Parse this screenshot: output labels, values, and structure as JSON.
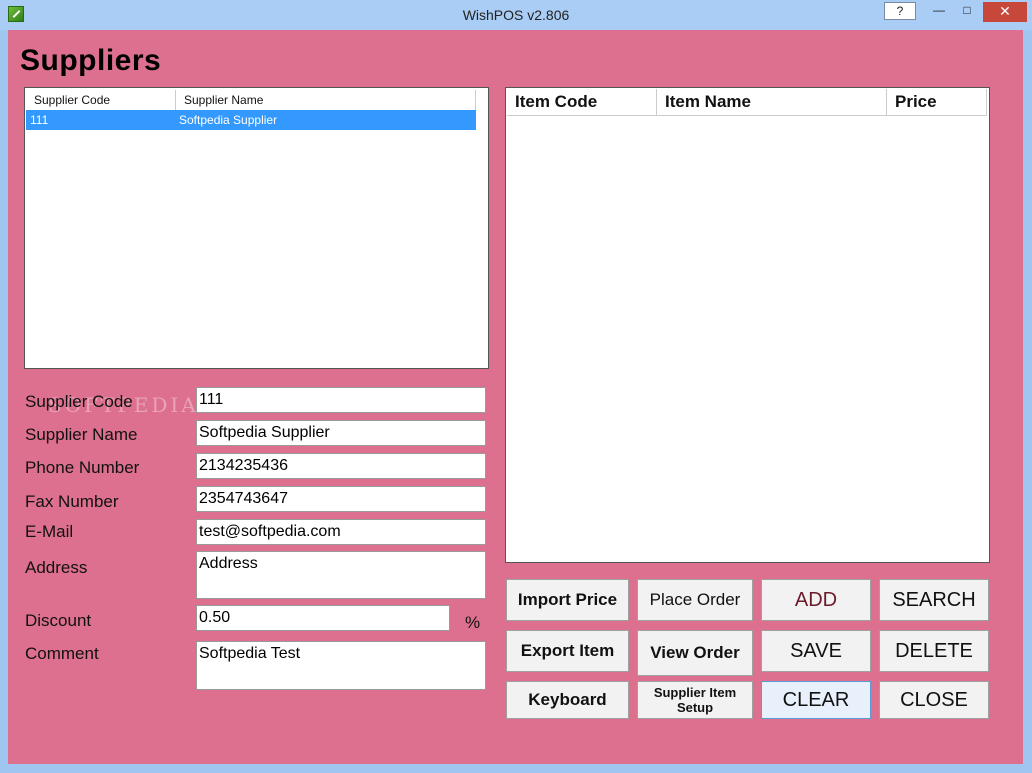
{
  "window": {
    "title": "WishPOS v2.806",
    "help_label": "?",
    "min_label": "—",
    "max_label": "□",
    "close_label": "✕"
  },
  "page": {
    "heading": "Suppliers"
  },
  "supplier_list": {
    "columns": [
      "Supplier Code",
      "Supplier Name"
    ],
    "rows": [
      {
        "code": "111",
        "name": "Softpedia Supplier",
        "selected": true
      }
    ]
  },
  "item_list": {
    "columns": [
      "Item Code",
      "Item Name",
      "Price"
    ]
  },
  "form": {
    "supplier_code": {
      "label": "Supplier Code",
      "value": "111"
    },
    "supplier_name": {
      "label": "Supplier Name",
      "value": "Softpedia Supplier"
    },
    "phone": {
      "label": "Phone Number",
      "value": "2134235436"
    },
    "fax": {
      "label": "Fax Number",
      "value": "2354743647"
    },
    "email": {
      "label": "E-Mail",
      "value": "test@softpedia.com"
    },
    "address": {
      "label": "Address",
      "value": "Address"
    },
    "discount": {
      "label": "Discount",
      "value": "0.50",
      "unit": "%"
    },
    "comment": {
      "label": "Comment",
      "value": "Softpedia Test"
    }
  },
  "buttons": {
    "import_price": "Import Price",
    "place_order": "Place Order",
    "add": "ADD",
    "search": "SEARCH",
    "export_item": "Export Item",
    "view_order": "View Order",
    "save": "SAVE",
    "delete": "DELETE",
    "keyboard": "Keyboard",
    "supplier_item_setup_line1": "Supplier Item",
    "supplier_item_setup_line2": "Setup",
    "clear": "CLEAR",
    "close": "CLOSE"
  },
  "watermark": "SOFTPEDIA",
  "colors": {
    "client_bg": "#dd708f",
    "selection": "#3399ff",
    "titlebar": "#a9cdf5",
    "close_button": "#c7473a",
    "add_text": "#6b1a2a"
  }
}
